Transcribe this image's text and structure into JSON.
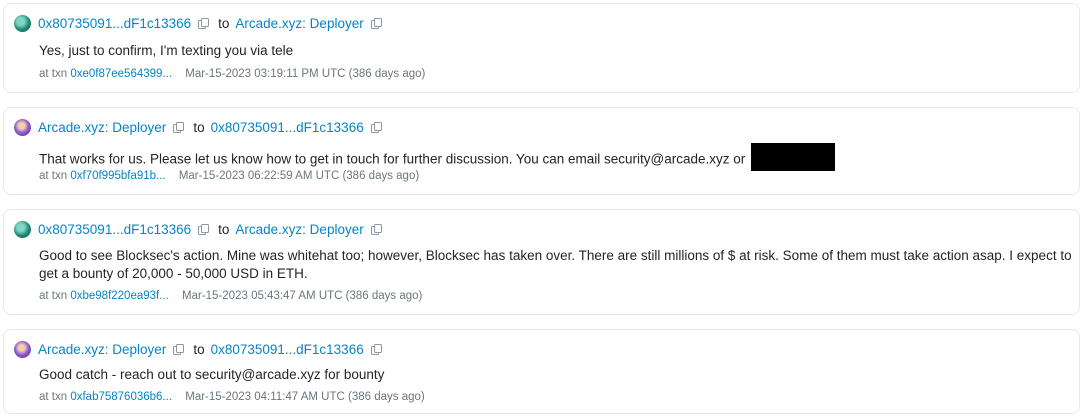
{
  "messages": [
    {
      "from": "0x80735091...dF1c13366",
      "to_word": "to",
      "to": "Arcade.xyz: Deployer",
      "avatar": "green-identicon",
      "body": "Yes, just to confirm, I'm texting you via tele",
      "at_txn_label": "at txn",
      "txn": "0xe0f87ee564399...",
      "time": "Mar-15-2023 03:19:11 PM UTC (386 days ago)"
    },
    {
      "from": "Arcade.xyz: Deployer",
      "to_word": "to",
      "to": "0x80735091...dF1c13366",
      "avatar": "purple-identicon",
      "body": "That works for us. Please let us know how to get in touch for further discussion. You can email security@arcade.xyz or",
      "at_txn_label": "at txn",
      "txn": "0xf70f995bfa91b...",
      "time": "Mar-15-2023 06:22:59 AM UTC (386 days ago)"
    },
    {
      "from": "0x80735091...dF1c13366",
      "to_word": "to",
      "to": "Arcade.xyz: Deployer",
      "avatar": "green-identicon",
      "body": "Good to see Blocksec's action. Mine was whitehat too; however, Blocksec has taken over. There are still millions of $ at risk. Some of them must take action asap. I expect to get a bounty of 20,000 - 50,000 USD in ETH.",
      "at_txn_label": "at txn",
      "txn": "0xbe98f220ea93f...",
      "time": "Mar-15-2023 05:43:47 AM UTC (386 days ago)"
    },
    {
      "from": "Arcade.xyz: Deployer",
      "to_word": "to",
      "to": "0x80735091...dF1c13366",
      "avatar": "purple-identicon",
      "body": "Good catch - reach out to security@arcade.xyz for bounty",
      "at_txn_label": "at txn",
      "txn": "0xfab75876036b6...",
      "time": "Mar-15-2023 04:11:47 AM UTC (386 days ago)"
    }
  ],
  "colors": {
    "link": "#0784c3",
    "text": "#212529",
    "muted": "#6c757d",
    "border": "#e6e8eb"
  }
}
